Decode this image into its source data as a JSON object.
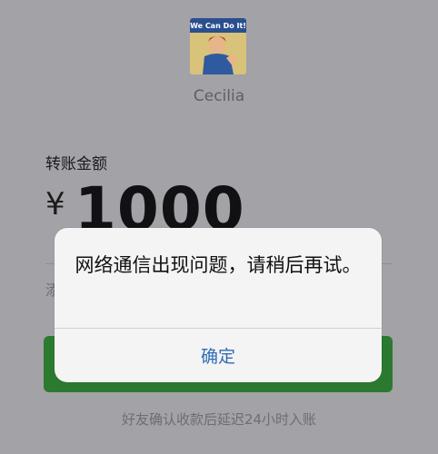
{
  "recipient": {
    "name": "Cecilia",
    "avatar_poster_text": "We Can Do It!"
  },
  "transfer": {
    "amount_label": "转账金额",
    "currency_symbol": "¥",
    "amount": "1000",
    "note_placeholder": "添"
  },
  "footer_text": "好友确认收款后延迟24小时入账",
  "dialog": {
    "message": "网络通信出现问题，请稍后再试。",
    "confirm_label": "确定"
  },
  "colors": {
    "background": "#a3a2a6",
    "transfer_button": "#2c7a2f",
    "dialog_button_text": "#2f6db5"
  }
}
